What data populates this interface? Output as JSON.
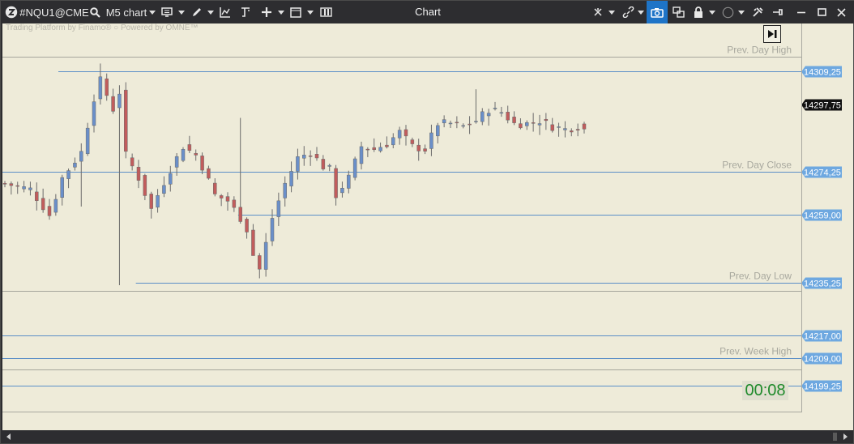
{
  "window": {
    "title": "Chart",
    "symbol": "#NQU1@CME",
    "timeframe": "M5 chart"
  },
  "chart_area": {
    "watermark": "Trading Platform by Finamo®  ○ Powered by OMNE™",
    "timer": "00:08",
    "background": "#eeebd9"
  },
  "chart_data": {
    "type": "candlestick",
    "ylim": [
      14190,
      14326
    ],
    "last_price": {
      "value": 14297.75,
      "label": "14297,75"
    },
    "levels": [
      {
        "value": 14314.5,
        "label": "Prev. Day High",
        "tag": null,
        "color": "#a6a69c",
        "from": 0
      },
      {
        "value": 14309.25,
        "label": null,
        "tag": "14309,25",
        "color": "#5b8fc7",
        "from": 0.07
      },
      {
        "value": 14274.25,
        "label": "Prev. Day Close",
        "tag": "14274,25",
        "color": "#5b8fc7",
        "from": 0
      },
      {
        "value": 14259.0,
        "label": null,
        "tag": "14259,00",
        "color": "#5b8fc7",
        "from": 0.295
      },
      {
        "value": 14235.25,
        "label": "Prev. Day Low",
        "tag": "14235,25",
        "color": "#5b8fc7",
        "from": 0.167
      },
      {
        "value": 14232.5,
        "label": null,
        "tag": null,
        "color": "#a6a69c",
        "from": 0
      },
      {
        "value": 14217.0,
        "label": null,
        "tag": "14217,00",
        "color": "#5b8fc7",
        "from": 0
      },
      {
        "value": 14209.0,
        "label": "Prev. Week High",
        "tag": "14209,00",
        "color": "#5b8fc7",
        "from": 0
      },
      {
        "value": 14205.0,
        "label": null,
        "tag": null,
        "color": "#a6a69c",
        "from": 0
      },
      {
        "value": 14199.25,
        "label": null,
        "tag": "14199,25",
        "color": "#5b8fc7",
        "from": 0
      }
    ],
    "close_path": [
      [
        0,
        14270
      ],
      [
        4,
        14268
      ],
      [
        7,
        14259
      ],
      [
        9,
        14272
      ],
      [
        12,
        14281
      ],
      [
        14,
        14300
      ],
      [
        15,
        14306
      ],
      [
        17,
        14296
      ],
      [
        18,
        14302
      ],
      [
        19,
        14280
      ],
      [
        21,
        14272
      ],
      [
        23,
        14261
      ],
      [
        24,
        14266
      ],
      [
        26,
        14275
      ],
      [
        28,
        14283
      ],
      [
        30,
        14280
      ],
      [
        31,
        14276
      ],
      [
        33,
        14266
      ],
      [
        35,
        14264
      ],
      [
        37,
        14258
      ],
      [
        38,
        14254
      ],
      [
        39,
        14245
      ],
      [
        40,
        14240
      ],
      [
        42,
        14258
      ],
      [
        44,
        14270
      ],
      [
        46,
        14279
      ],
      [
        48,
        14281
      ],
      [
        50,
        14276
      ],
      [
        51,
        14275
      ],
      [
        52,
        14266
      ],
      [
        54,
        14272
      ],
      [
        56,
        14283
      ],
      [
        58,
        14282
      ],
      [
        60,
        14284
      ],
      [
        62,
        14288
      ],
      [
        64,
        14283
      ],
      [
        66,
        14282
      ],
      [
        68,
        14291
      ],
      [
        70,
        14291
      ],
      [
        72,
        14290
      ],
      [
        74,
        14292
      ],
      [
        76,
        14296
      ],
      [
        78,
        14295
      ],
      [
        80,
        14291
      ],
      [
        82,
        14291
      ],
      [
        84,
        14292
      ],
      [
        86,
        14290
      ],
      [
        88,
        14289
      ],
      [
        90,
        14290
      ],
      [
        91,
        14289
      ]
    ],
    "close_path_x_units": "candle index (92 candles; x is in candles, y in price)",
    "low_spikes": [
      {
        "i": 18,
        "low": 14234.5
      },
      {
        "i": 39,
        "low": 14252
      },
      {
        "i": 12,
        "low": 14262
      }
    ],
    "high_spikes": [
      {
        "i": 15,
        "high": 14312
      },
      {
        "i": 37,
        "high": 14293
      },
      {
        "i": 74,
        "high": 14303
      }
    ]
  },
  "colors": {
    "up": "#6a8fc9",
    "down": "#c15c5c",
    "level": "#5b8fc7",
    "neutral_line": "#a6a69c",
    "tag_bg": "#6ea8e0",
    "tag_text": "#ffffff",
    "last_tag_bg": "#111111"
  },
  "toolbar": {
    "icons": [
      "app-logo",
      "search",
      "indicator",
      "draw",
      "trend-line",
      "fibonacci",
      "crosshair",
      "window",
      "layout"
    ],
    "right_icons": [
      "cursor-star",
      "link",
      "screenshot",
      "multi-window",
      "lock",
      "circle",
      "tools",
      "pin"
    ]
  }
}
